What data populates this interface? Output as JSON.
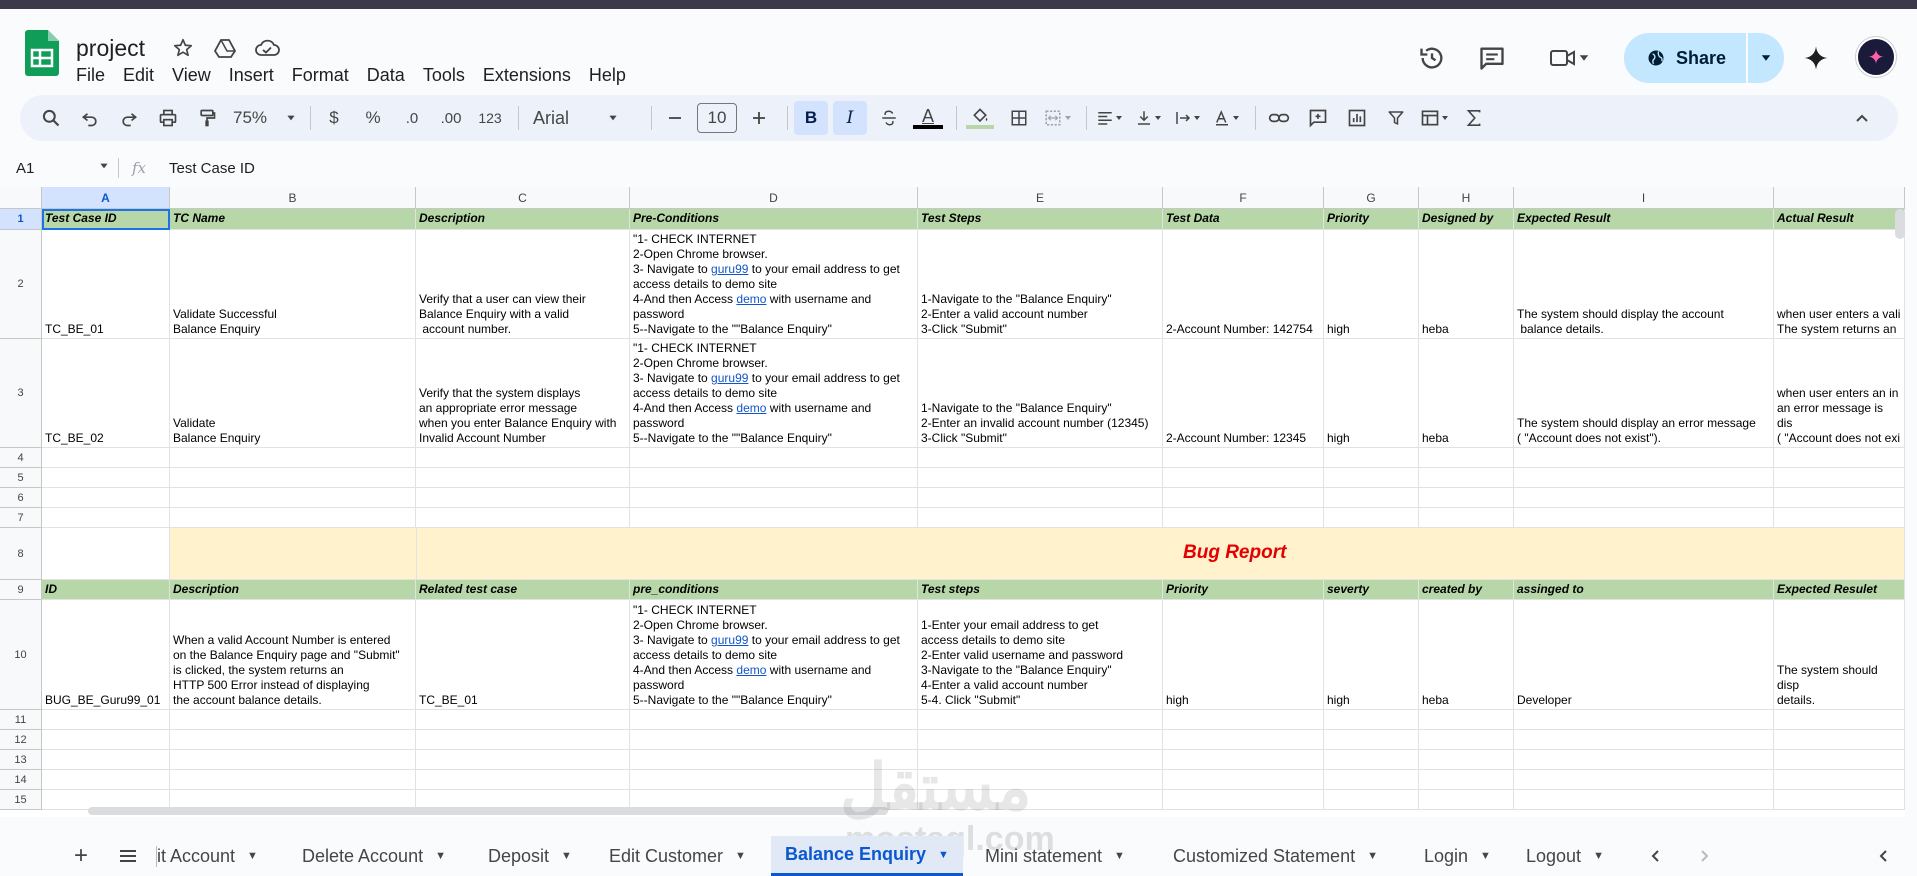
{
  "app": {
    "doc_title": "project",
    "menu": [
      "File",
      "Edit",
      "View",
      "Insert",
      "Format",
      "Data",
      "Tools",
      "Extensions",
      "Help"
    ],
    "share_label": "Share",
    "brand_color": "#0f9d58"
  },
  "toolbar": {
    "zoom": "75%",
    "currency": "$",
    "percent": "%",
    "decrease_decimals": ".0",
    "increase_decimals": ".00",
    "number_format": "123",
    "font": "Arial",
    "font_size": "10",
    "bold": "B",
    "italic": "I",
    "text_color_glyph": "A"
  },
  "formula": {
    "cell_ref": "A1",
    "fx": "fx",
    "value": "Test Case ID"
  },
  "columns": [
    "A",
    "B",
    "C",
    "D",
    "E",
    "F",
    "G",
    "H",
    "I"
  ],
  "rows": [
    "1",
    "2",
    "3",
    "4",
    "5",
    "6",
    "7",
    "8",
    "9",
    "10",
    "11",
    "12",
    "13",
    "14",
    "15"
  ],
  "headers1": [
    "Test Case ID",
    "TC Name",
    "Description",
    "Pre-Conditions",
    "Test Steps",
    "Test Data",
    "Priority",
    "Designed by",
    "Expected Result",
    "Actual Result"
  ],
  "row2": {
    "a": "TC_BE_01",
    "b": "Validate Successful\nBalance Enquiry",
    "c": "Verify that a user can view their\nBalance Enquiry with a valid\n account number.",
    "d_1": "\"1- CHECK INTERNET\n2-Open Chrome browser.\n3- Navigate to ",
    "d_link1": "guru99",
    "d_2": " to your email address to get access details to demo site\n4-And then Access ",
    "d_link2": "demo",
    "d_3": " with username and password\n5--Navigate to the \"\"Balance Enquiry\"",
    "e": "1-Navigate to the \"Balance Enquiry\"\n2-Enter a valid account number\n3-Click \"Submit\"",
    "f": "2-Account Number: 142754",
    "g": "high",
    "h": "heba",
    "i": "The system should display the account\n balance details.",
    "j": "when user enters a vali\nThe system returns an"
  },
  "row3": {
    "a": "TC_BE_02",
    "b": "Validate\nBalance Enquiry",
    "c": "Verify that the system displays\nan appropriate error message\nwhen you enter Balance Enquiry with\nInvalid Account Number",
    "d_1": "\"1- CHECK INTERNET\n2-Open Chrome browser.\n3- Navigate to ",
    "d_link1": "guru99",
    "d_2": " to your email address to get access details to demo site\n4-And then Access ",
    "d_link2": "demo",
    "d_3": " with username and password\n5--Navigate to the \"\"Balance Enquiry\"",
    "e": "1-Navigate to the \"Balance Enquiry\"\n2-Enter an invalid account number (12345)\n3-Click \"Submit\"",
    "f": "2-Account Number: 12345",
    "g": "high",
    "h": "heba",
    "i": "The system should display an error message\n( \"Account does not exist\").",
    "j": "when user enters an in\nan error message is dis\n( \"Account does not exi"
  },
  "bug_report_title": "Bug Report",
  "headers9": [
    "ID",
    "Description",
    "Related test case",
    "pre_conditions",
    "Test steps",
    "Priority",
    "severty",
    "created by",
    "assinged to",
    "Expected Resulet"
  ],
  "row10": {
    "a": "BUG_BE_Guru99_01",
    "b": "When a valid Account Number is entered\non the Balance Enquiry page and \"Submit\"\nis clicked, the system returns an\nHTTP 500 Error instead of displaying\nthe account balance details.",
    "c": "TC_BE_01",
    "d_1": "\"1- CHECK INTERNET\n2-Open Chrome browser.\n3- Navigate to ",
    "d_link1": "guru99",
    "d_2": " to your email address to get access details to demo site\n4-And then Access ",
    "d_link2": "demo",
    "d_3": " with username and password\n5--Navigate to the \"\"Balance Enquiry\"",
    "e": "1-Enter your email address to get\naccess details to demo site\n2-Enter valid username and password\n3-Navigate to the \"Balance Enquiry\"\n4-Enter a valid account number\n5-4. Click \"Submit\"",
    "f": "high",
    "g": "high",
    "h": "heba",
    "i": "Developer",
    "j": "The system should disp\ndetails."
  },
  "sheet_tabs": [
    "it Account",
    "Delete Account",
    "Deposit",
    "Edit Customer",
    "Balance Enquiry",
    "Mini statement",
    "Customized Statement",
    "Login",
    "Logout"
  ],
  "active_tab": "Balance Enquiry",
  "watermark": "مستقل",
  "watermark_url": "mostaql.com"
}
